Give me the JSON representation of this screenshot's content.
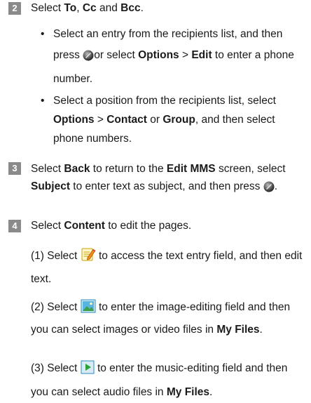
{
  "step2": {
    "num": "2",
    "parts": {
      "a": "Select ",
      "to": "To",
      "b": ", ",
      "cc": "Cc",
      "c": " and ",
      "bcc": "Bcc",
      "d": "."
    },
    "bullet1": {
      "a": "Select an entry from the recipients list, and then press ",
      "b": "or select ",
      "options": "Options",
      "gt": " > ",
      "edit": "Edit",
      "c": " to enter a phone number."
    },
    "bullet2": {
      "a": "Select a position from the recipients list, select ",
      "options": "Options",
      "gt": " > ",
      "contact": "Contact",
      "or": " or ",
      "group": "Group",
      "b": ", and then select phone numbers."
    }
  },
  "step3": {
    "num": "3",
    "a": "Select ",
    "back": "Back",
    "b": " to return to the ",
    "editmms": "Edit MMS",
    "c": " screen, select ",
    "subject": "Subject",
    "d": " to enter text as subject, and then press ",
    "e": "."
  },
  "step4": {
    "num": "4",
    "a": "Select ",
    "content": "Content",
    "b": " to edit the pages.",
    "p1": {
      "a": "(1) Select ",
      "b": " to access the text entry field, and then edit text."
    },
    "p2": {
      "a": "(2) Select ",
      "b": " to enter the image-editing field and then you can select images or video files in ",
      "myfiles": "My Files",
      "c": "."
    },
    "p3": {
      "a": "(3) Select ",
      "b": " to enter the music-editing field and then you can select audio files in ",
      "myfiles": "My Files",
      "c": "."
    }
  },
  "icons": {
    "key": "joystick-key-icon",
    "text": "text-edit-icon",
    "image": "image-icon",
    "music": "music-play-icon"
  }
}
